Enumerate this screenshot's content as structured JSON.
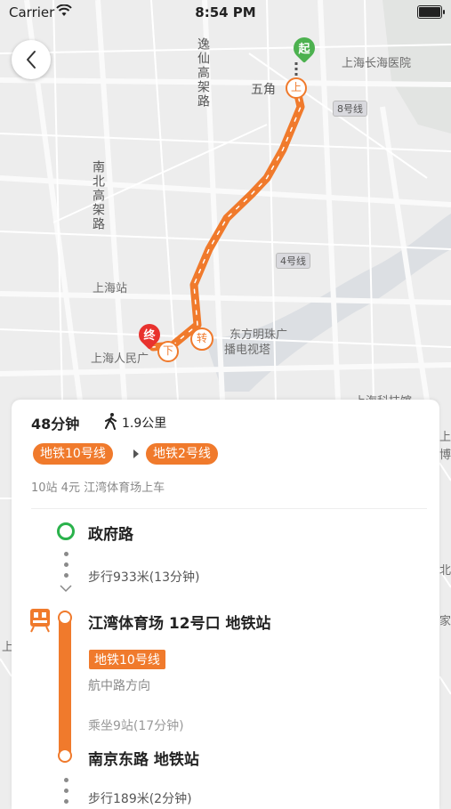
{
  "status_bar": {
    "carrier": "Carrier",
    "time": "8:54 PM"
  },
  "map": {
    "labels": {
      "hospital": "上海长海医院",
      "wujiao": "五角",
      "line8": "8号线",
      "line4": "4号线",
      "shanghai_station": "上海站",
      "peoples_square": "上海人民广",
      "pearl_tower_1": "东方明珠广",
      "pearl_tower_2": "播电视塔",
      "yixian_road": "逸仙高架路",
      "nanbei_road": "南北高架路",
      "edge_bottom": "上海科技馆",
      "edge_right_1": "上汽",
      "edge_right_2": "博",
      "edge_right_3": "北",
      "edge_right_4": "家",
      "edge_left": "上"
    },
    "markers": {
      "start": "起",
      "board": "上",
      "alight": "下",
      "transfer": "转",
      "end": "终"
    },
    "colors": {
      "route": "#f07a2c",
      "start": "#4cb14f",
      "end": "#e8322e"
    }
  },
  "route": {
    "duration": "48分钟",
    "walk_distance": "1.9公里",
    "lines": [
      "地铁10号线",
      "地铁2号线"
    ],
    "sub_info": "10站 4元 江湾体育场上车"
  },
  "steps": [
    {
      "station": "政府路"
    },
    {
      "walk": "步行933米(13分钟)"
    },
    {
      "station": "江湾体育场 12号口 地铁站"
    },
    {
      "line_tag": "地铁10号线",
      "direction": "航中路方向",
      "ride": "乘坐9站(17分钟)"
    },
    {
      "station": "南京东路  地铁站"
    },
    {
      "walk": "步行189米(2分钟)"
    }
  ]
}
